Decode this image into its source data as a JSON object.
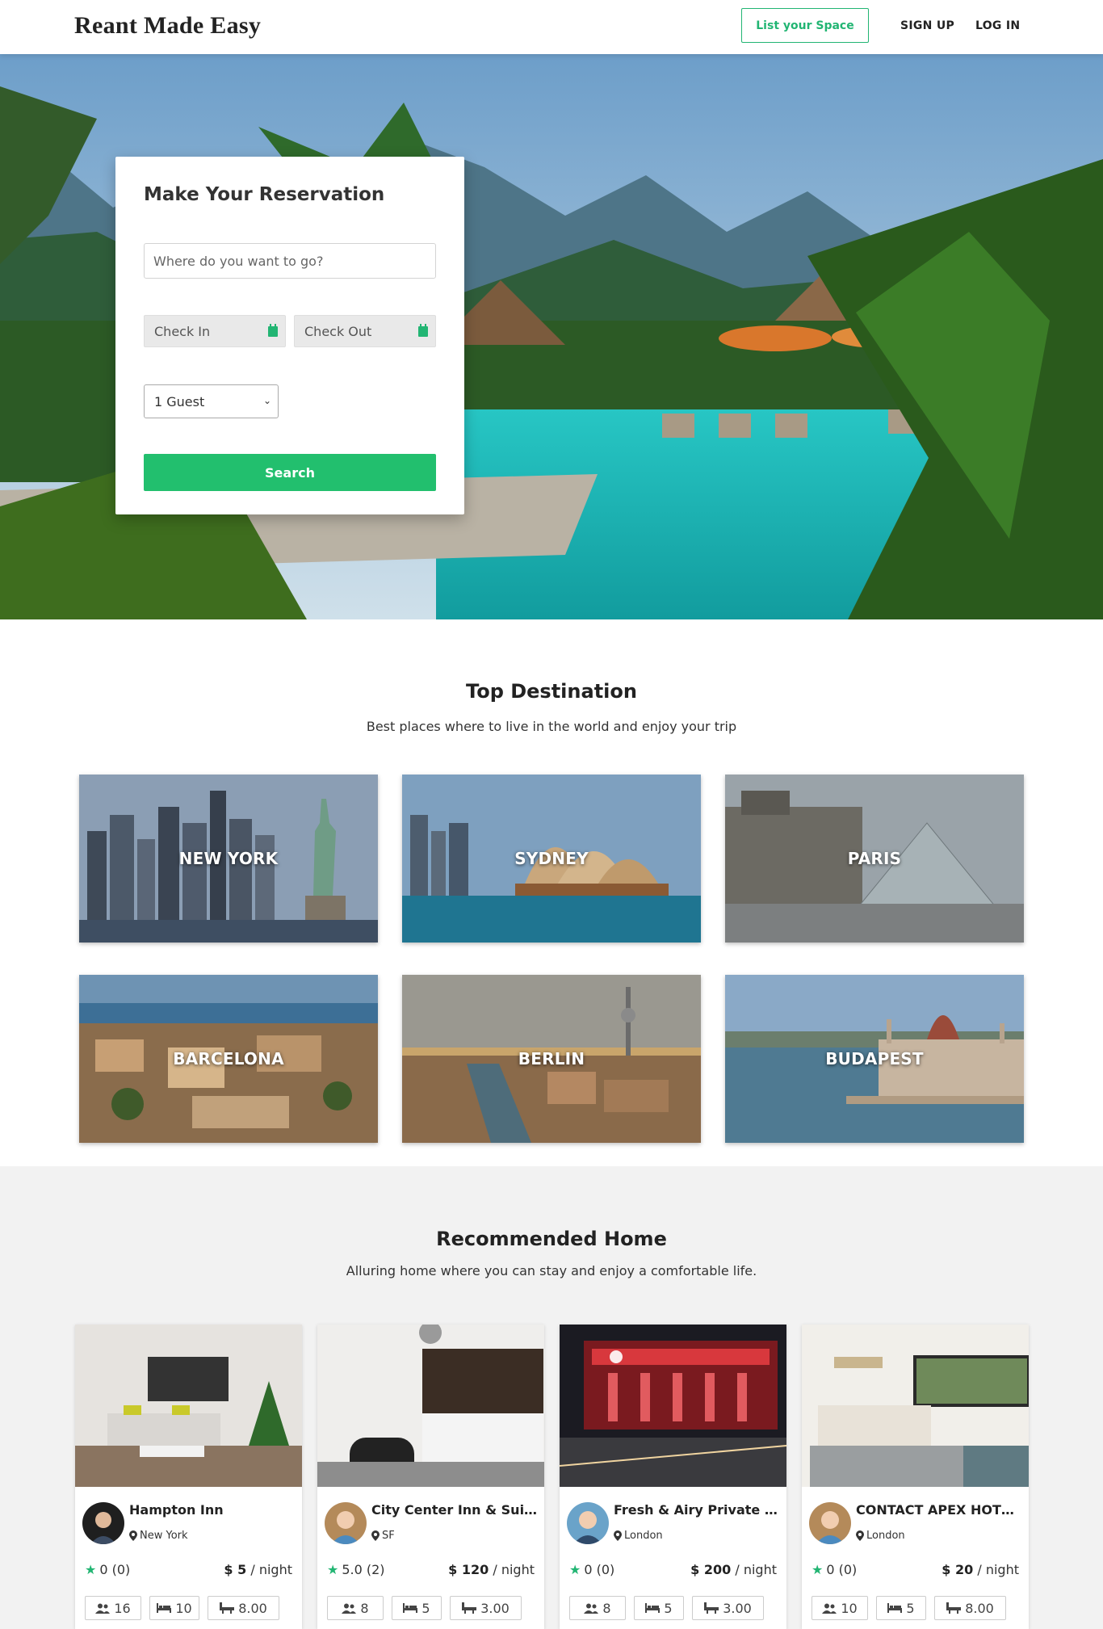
{
  "nav": {
    "logo": "Reant Made Easy",
    "list_space": "List your Space",
    "sign_up": "SIGN UP",
    "log_in": "LOG IN"
  },
  "reservation": {
    "title": "Make Your Reservation",
    "destination_placeholder": "Where do you want to go?",
    "check_in": "Check In",
    "check_out": "Check Out",
    "guests_selected": "1 Guest",
    "search": "Search"
  },
  "top_destination": {
    "title": "Top Destination",
    "subtitle": "Best places where to live in the world and enjoy your trip",
    "cities": [
      "NEW YORK",
      "SYDNEY",
      "PARIS",
      "BARCELONA",
      "BERLIN",
      "BUDAPEST"
    ]
  },
  "recommended": {
    "title": "Recommended Home",
    "subtitle": "Alluring home where you can stay and enjoy a comfortable life.",
    "price_unit": "/ night",
    "homes": [
      {
        "name": "Hampton Inn",
        "location": "New York",
        "rating": "0 (0)",
        "price": "$ 5",
        "guests": "16",
        "beds": "10",
        "baths": "8.00"
      },
      {
        "name": "City Center Inn & Suites",
        "location": "SF",
        "rating": "5.0 (2)",
        "price": "$ 120",
        "guests": "8",
        "beds": "5",
        "baths": "3.00"
      },
      {
        "name": "Fresh & Airy Private Bus...",
        "location": "London",
        "rating": "0 (0)",
        "price": "$ 200",
        "guests": "8",
        "beds": "5",
        "baths": "3.00"
      },
      {
        "name": "CONTACT APEX HOTELS",
        "location": "London",
        "rating": "0 (0)",
        "price": "$ 20",
        "guests": "10",
        "beds": "5",
        "baths": "8.00"
      }
    ]
  },
  "colors": {
    "accent": "#22b573"
  }
}
